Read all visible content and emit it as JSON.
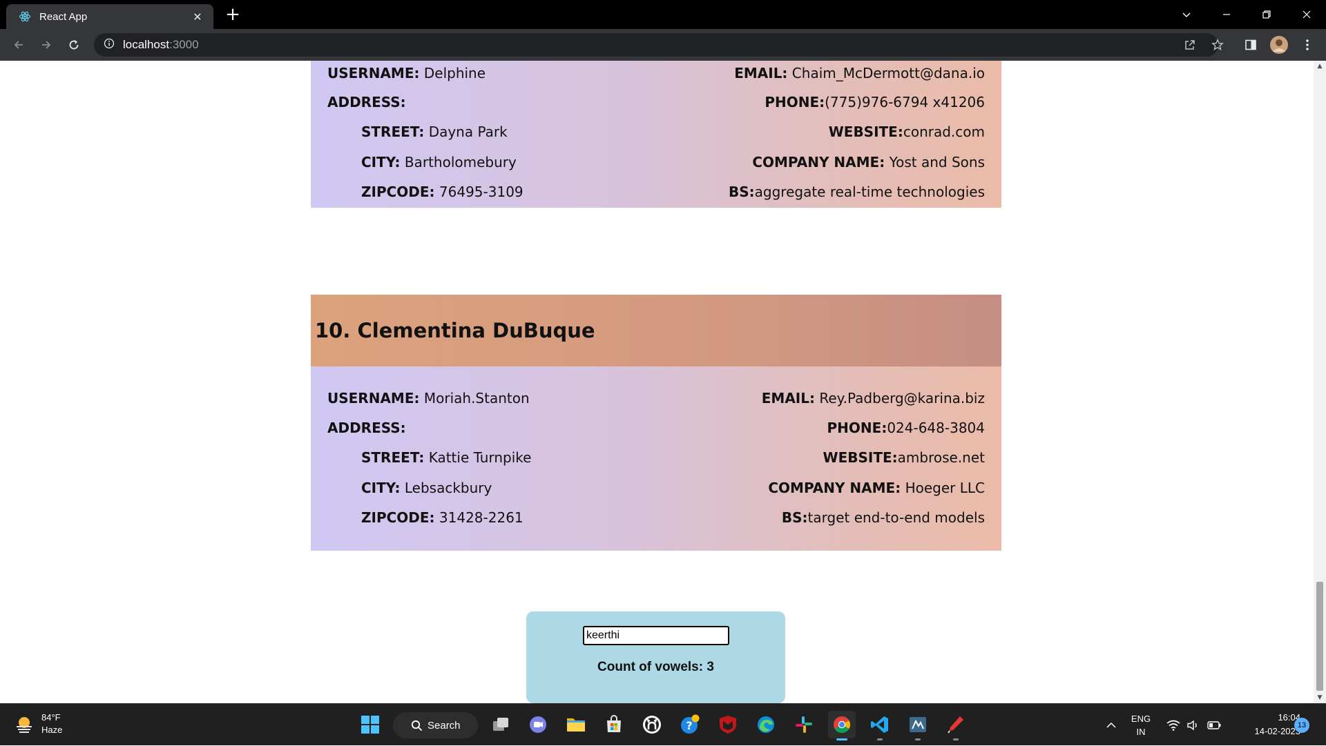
{
  "browser": {
    "tab_title": "React App",
    "url_host": "localhost",
    "url_port": ":3000"
  },
  "cards": [
    {
      "heading": "",
      "username_label": "USERNAME:",
      "username": "Delphine",
      "address_label": "ADDRESS:",
      "street_label": "STREET:",
      "street": "Dayna Park",
      "city_label": "CITY:",
      "city": "Bartholomebury",
      "zipcode_label": "ZIPCODE:",
      "zipcode": "76495-3109",
      "email_label": "EMAIL:",
      "email": "Chaim_McDermott@dana.io",
      "phone_label": "PHONE:",
      "phone": "(775)976-6794 x41206",
      "website_label": "WEBSITE:",
      "website": "conrad.com",
      "company_label": "COMPANY NAME:",
      "company": "Yost and Sons",
      "bs_label": "BS:",
      "bs": "aggregate real-time technologies"
    },
    {
      "heading": "10. Clementina DuBuque",
      "username_label": "USERNAME:",
      "username": "Moriah.Stanton",
      "address_label": "ADDRESS:",
      "street_label": "STREET:",
      "street": "Kattie Turnpike",
      "city_label": "CITY:",
      "city": "Lebsackbury",
      "zipcode_label": "ZIPCODE:",
      "zipcode": "31428-2261",
      "email_label": "EMAIL:",
      "email": "Rey.Padberg@karina.biz",
      "phone_label": "PHONE:",
      "phone": "024-648-3804",
      "website_label": "WEBSITE:",
      "website": "ambrose.net",
      "company_label": "COMPANY NAME:",
      "company": "Hoeger LLC",
      "bs_label": "BS:",
      "bs": "target end-to-end models"
    }
  ],
  "vowel_counter": {
    "input_value": "keerthi",
    "result_label": "Count of vowels:",
    "result_value": "3"
  },
  "taskbar": {
    "weather_temp": "84°F",
    "weather_desc": "Haze",
    "search_label": "Search",
    "lang_line1": "ENG",
    "lang_line2": "IN",
    "time": "16:04",
    "date": "14-02-2023",
    "notification_count": "13"
  },
  "colors": {
    "card_header_start": "#dca27c",
    "card_header_end": "#c68e84",
    "card_body_start": "#d0c8f3",
    "card_body_end": "#ebbba8",
    "vowel_box": "#add8e6",
    "browser_toolbar": "#35363a"
  }
}
